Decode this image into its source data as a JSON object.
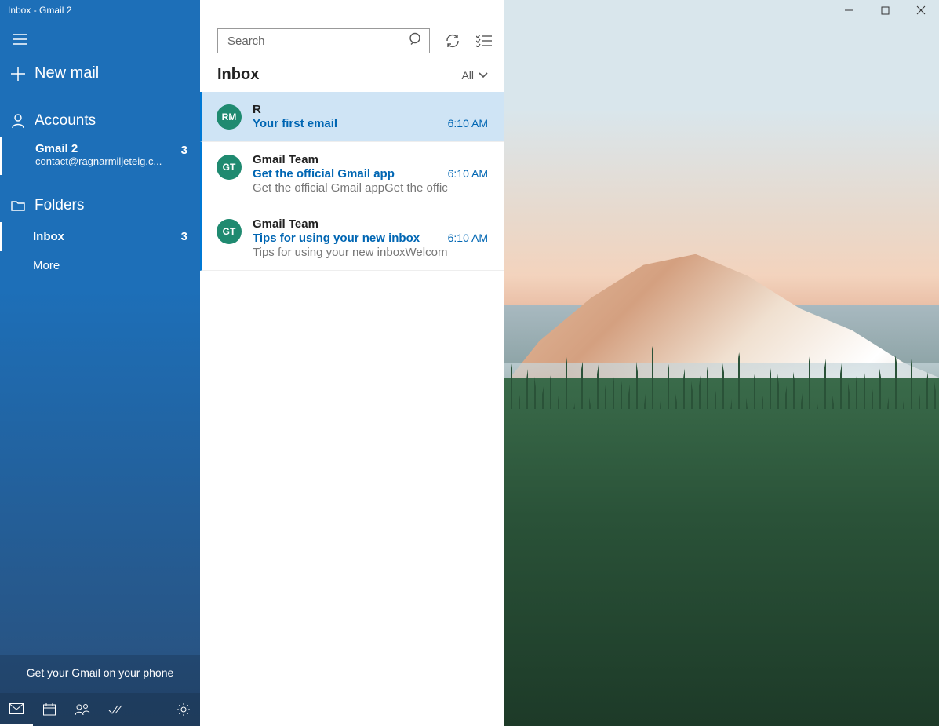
{
  "window": {
    "title": "Inbox - Gmail 2"
  },
  "sidebar": {
    "new_mail_label": "New mail",
    "accounts_label": "Accounts",
    "folders_label": "Folders",
    "account": {
      "name": "Gmail 2",
      "email": "contact@ragnarmiljeteig.c...",
      "count": "3"
    },
    "folders": {
      "inbox": {
        "name": "Inbox",
        "count": "3"
      },
      "more": {
        "name": "More"
      }
    },
    "promo": "Get your Gmail on your phone"
  },
  "toolbar": {
    "search_placeholder": "Search"
  },
  "list": {
    "title": "Inbox",
    "filter_label": "All"
  },
  "messages": [
    {
      "avatar_initials": "RM",
      "avatar_color": "#1f8a70",
      "sender": "R",
      "subject": "Your first email",
      "preview": "",
      "time": "6:10 AM",
      "selected": true
    },
    {
      "avatar_initials": "GT",
      "avatar_color": "#1f8a70",
      "sender": "Gmail Team",
      "subject": "Get the official Gmail app",
      "preview": "Get the official Gmail appGet the offic",
      "time": "6:10 AM",
      "selected": false
    },
    {
      "avatar_initials": "GT",
      "avatar_color": "#1f8a70",
      "sender": "Gmail Team",
      "subject": "Tips for using your new inbox",
      "preview": "Tips for using your new inboxWelcom",
      "time": "6:10 AM",
      "selected": false
    }
  ]
}
